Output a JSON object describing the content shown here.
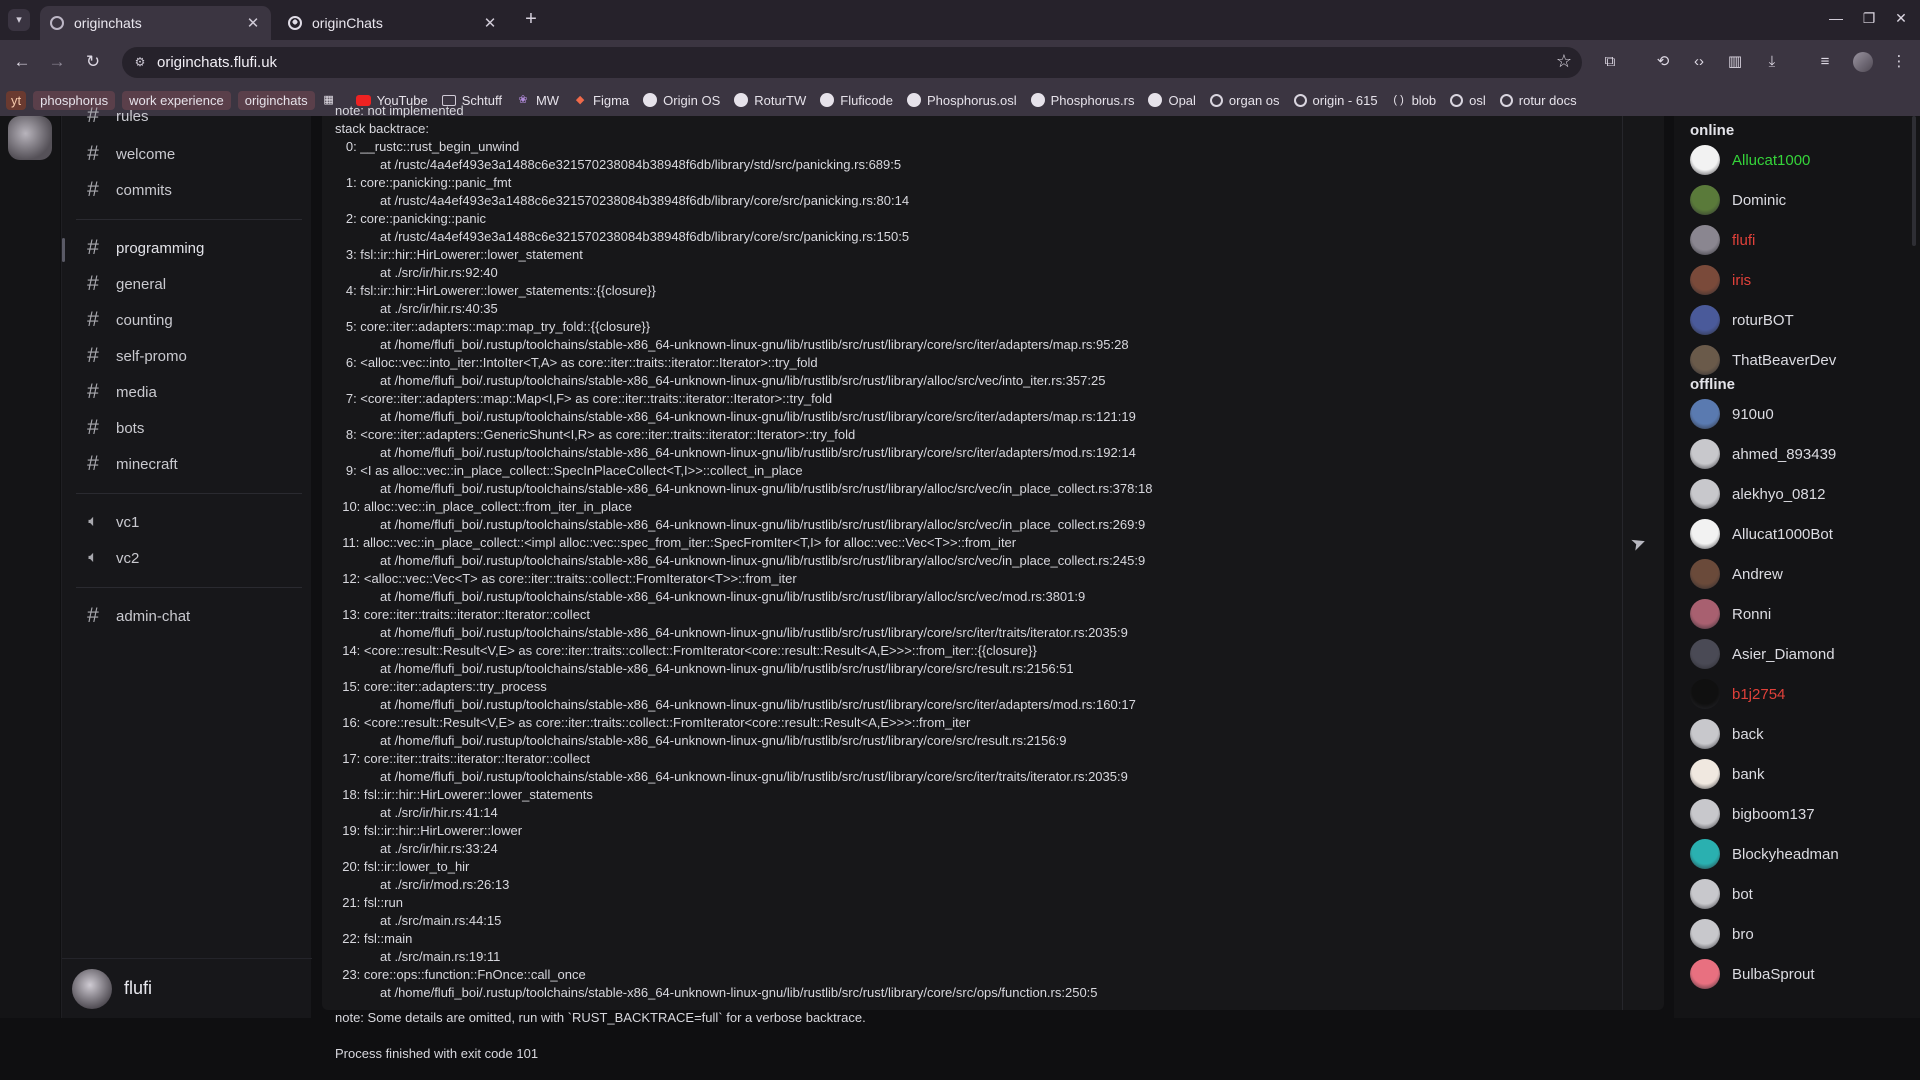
{
  "browser": {
    "tabs": [
      {
        "title": "originchats",
        "active": true
      },
      {
        "title": "originChats",
        "active": false
      }
    ],
    "url": "originchats.flufi.uk",
    "bookmarks": [
      {
        "label": "yt",
        "kind": "pill-yt"
      },
      {
        "label": "phosphorus",
        "kind": "pill"
      },
      {
        "label": "work experience",
        "kind": "pill"
      },
      {
        "label": "originchats",
        "kind": "pill"
      },
      {
        "label": "",
        "kind": "apps-grid-icon"
      },
      {
        "label": "YouTube",
        "kind": "youtube-icon"
      },
      {
        "label": "Schtuff",
        "kind": "folder-icon"
      },
      {
        "label": "MW",
        "kind": "mw-icon"
      },
      {
        "label": "Figma",
        "kind": "figma-icon"
      },
      {
        "label": "Origin OS",
        "kind": "github-icon"
      },
      {
        "label": "RoturTW",
        "kind": "github-icon"
      },
      {
        "label": "Fluficode",
        "kind": "github-icon"
      },
      {
        "label": "Phosphorus.osl",
        "kind": "github-icon"
      },
      {
        "label": "Phosphorus.rs",
        "kind": "github-icon"
      },
      {
        "label": "Opal",
        "kind": "github-icon"
      },
      {
        "label": "organ os",
        "kind": "rotur-icon"
      },
      {
        "label": "origin - 615",
        "kind": "rotur-icon"
      },
      {
        "label": "blob",
        "kind": "blob-icon"
      },
      {
        "label": "osl",
        "kind": "rotur-icon"
      },
      {
        "label": "rotur docs",
        "kind": "rotur-icon"
      }
    ]
  },
  "channels": {
    "top_partial": "rules",
    "group1": [
      "welcome",
      "commits"
    ],
    "group2": [
      "programming",
      "general",
      "counting",
      "self-promo",
      "media",
      "bots",
      "minecraft"
    ],
    "voice": [
      "vc1",
      "vc2"
    ],
    "group3": [
      "admin-chat"
    ],
    "selected": "programming"
  },
  "user": {
    "name": "flufi"
  },
  "log": {
    "partial_top": "note: not implemented",
    "lines": [
      "stack backtrace:",
      "   0: __rustc::rust_begin_unwind",
      "at /rustc/4a4ef493e3a1488c6e321570238084b38948f6db/library/std/src/panicking.rs:689:5",
      "   1: core::panicking::panic_fmt",
      "at /rustc/4a4ef493e3a1488c6e321570238084b38948f6db/library/core/src/panicking.rs:80:14",
      "   2: core::panicking::panic",
      "at /rustc/4a4ef493e3a1488c6e321570238084b38948f6db/library/core/src/panicking.rs:150:5",
      "   3: fsl::ir::hir::HirLowerer::lower_statement",
      "at ./src/ir/hir.rs:92:40",
      "   4: fsl::ir::hir::HirLowerer::lower_statements::{{closure}}",
      "at ./src/ir/hir.rs:40:35",
      "   5: core::iter::adapters::map::map_try_fold::{{closure}}",
      "at /home/flufi_boi/.rustup/toolchains/stable-x86_64-unknown-linux-gnu/lib/rustlib/src/rust/library/core/src/iter/adapters/map.rs:95:28",
      "   6: <alloc::vec::into_iter::IntoIter<T,A> as core::iter::traits::iterator::Iterator>::try_fold",
      "at /home/flufi_boi/.rustup/toolchains/stable-x86_64-unknown-linux-gnu/lib/rustlib/src/rust/library/alloc/src/vec/into_iter.rs:357:25",
      "   7: <core::iter::adapters::map::Map<I,F> as core::iter::traits::iterator::Iterator>::try_fold",
      "at /home/flufi_boi/.rustup/toolchains/stable-x86_64-unknown-linux-gnu/lib/rustlib/src/rust/library/core/src/iter/adapters/map.rs:121:19",
      "   8: <core::iter::adapters::GenericShunt<I,R> as core::iter::traits::iterator::Iterator>::try_fold",
      "at /home/flufi_boi/.rustup/toolchains/stable-x86_64-unknown-linux-gnu/lib/rustlib/src/rust/library/core/src/iter/adapters/mod.rs:192:14",
      "   9: <I as alloc::vec::in_place_collect::SpecInPlaceCollect<T,I>>::collect_in_place",
      "at /home/flufi_boi/.rustup/toolchains/stable-x86_64-unknown-linux-gnu/lib/rustlib/src/rust/library/alloc/src/vec/in_place_collect.rs:378:18",
      "  10: alloc::vec::in_place_collect::from_iter_in_place",
      "at /home/flufi_boi/.rustup/toolchains/stable-x86_64-unknown-linux-gnu/lib/rustlib/src/rust/library/alloc/src/vec/in_place_collect.rs:269:9",
      "  11: alloc::vec::in_place_collect::<impl alloc::vec::spec_from_iter::SpecFromIter<T,I> for alloc::vec::Vec<T>>::from_iter",
      "at /home/flufi_boi/.rustup/toolchains/stable-x86_64-unknown-linux-gnu/lib/rustlib/src/rust/library/alloc/src/vec/in_place_collect.rs:245:9",
      "  12: <alloc::vec::Vec<T> as core::iter::traits::collect::FromIterator<T>>::from_iter",
      "at /home/flufi_boi/.rustup/toolchains/stable-x86_64-unknown-linux-gnu/lib/rustlib/src/rust/library/alloc/src/vec/mod.rs:3801:9",
      "  13: core::iter::traits::iterator::Iterator::collect",
      "at /home/flufi_boi/.rustup/toolchains/stable-x86_64-unknown-linux-gnu/lib/rustlib/src/rust/library/core/src/iter/traits/iterator.rs:2035:9",
      "  14: <core::result::Result<V,E> as core::iter::traits::collect::FromIterator<core::result::Result<A,E>>>::from_iter::{{closure}}",
      "at /home/flufi_boi/.rustup/toolchains/stable-x86_64-unknown-linux-gnu/lib/rustlib/src/rust/library/core/src/result.rs:2156:51",
      "  15: core::iter::adapters::try_process",
      "at /home/flufi_boi/.rustup/toolchains/stable-x86_64-unknown-linux-gnu/lib/rustlib/src/rust/library/core/src/iter/adapters/mod.rs:160:17",
      "  16: <core::result::Result<V,E> as core::iter::traits::collect::FromIterator<core::result::Result<A,E>>>::from_iter",
      "at /home/flufi_boi/.rustup/toolchains/stable-x86_64-unknown-linux-gnu/lib/rustlib/src/rust/library/core/src/result.rs:2156:9",
      "  17: core::iter::traits::iterator::Iterator::collect",
      "at /home/flufi_boi/.rustup/toolchains/stable-x86_64-unknown-linux-gnu/lib/rustlib/src/rust/library/core/src/iter/traits/iterator.rs:2035:9",
      "  18: fsl::ir::hir::HirLowerer::lower_statements",
      "at ./src/ir/hir.rs:41:14",
      "  19: fsl::ir::hir::HirLowerer::lower",
      "at ./src/ir/hir.rs:33:24",
      "  20: fsl::ir::lower_to_hir",
      "at ./src/ir/mod.rs:26:13",
      "  21: fsl::run",
      "at ./src/main.rs:44:15",
      "  22: fsl::main",
      "at ./src/main.rs:19:11",
      "  23: core::ops::function::FnOnce::call_once",
      "at /home/flufi_boi/.rustup/toolchains/stable-x86_64-unknown-linux-gnu/lib/rustlib/src/rust/library/core/src/ops/function.rs:250:5"
    ],
    "note": "note: Some details are omitted, run with `RUST_BACKTRACE=full` for a verbose backtrace.",
    "exit": "Process finished with exit code 101"
  },
  "members": {
    "online_label": "online",
    "offline_label": "offline",
    "online": [
      {
        "name": "Allucat1000",
        "color": "#35d43a",
        "avatar": "#f2f2f2"
      },
      {
        "name": "Dominic",
        "color": "#dcdce2",
        "avatar": "#5a7a3a"
      },
      {
        "name": "flufi",
        "color": "#e0413a",
        "avatar": "#8a8690"
      },
      {
        "name": "iris",
        "color": "#e0413a",
        "avatar": "#7a4a3a"
      },
      {
        "name": "roturBOT",
        "color": "#dcdce2",
        "avatar": "#4a5a9a"
      },
      {
        "name": "ThatBeaverDev",
        "color": "#dcdce2",
        "avatar": "#6a5a4a"
      }
    ],
    "offline": [
      {
        "name": "910u0",
        "color": "#dcdce2",
        "avatar": "#5a7ab0"
      },
      {
        "name": "ahmed_893439",
        "color": "#dcdce2",
        "avatar": "#c8c8cc"
      },
      {
        "name": "alekhyo_0812",
        "color": "#dcdce2",
        "avatar": "#c8c8cc"
      },
      {
        "name": "Allucat1000Bot",
        "color": "#dcdce2",
        "avatar": "#f2f2f2"
      },
      {
        "name": "Andrew",
        "color": "#dcdce2",
        "avatar": "#6a4a3a"
      },
      {
        "name": "Ronni",
        "color": "#dcdce2",
        "avatar": "#a86070"
      },
      {
        "name": "Asier_Diamond",
        "color": "#dcdce2",
        "avatar": "#4a4a55"
      },
      {
        "name": "b1j2754",
        "color": "#e0413a",
        "avatar": "#101010"
      },
      {
        "name": "back",
        "color": "#dcdce2",
        "avatar": "#c8c8cc"
      },
      {
        "name": "bank",
        "color": "#dcdce2",
        "avatar": "#f0e8e0"
      },
      {
        "name": "bigboom137",
        "color": "#dcdce2",
        "avatar": "#c8c8cc"
      },
      {
        "name": "Blockyheadman",
        "color": "#dcdce2",
        "avatar": "#2ab0b0"
      },
      {
        "name": "bot",
        "color": "#dcdce2",
        "avatar": "#c8c8cc"
      },
      {
        "name": "bro",
        "color": "#dcdce2",
        "avatar": "#c8c8cc"
      },
      {
        "name": "BulbaSprout",
        "color": "#dcdce2",
        "avatar": "#e87080"
      }
    ]
  }
}
